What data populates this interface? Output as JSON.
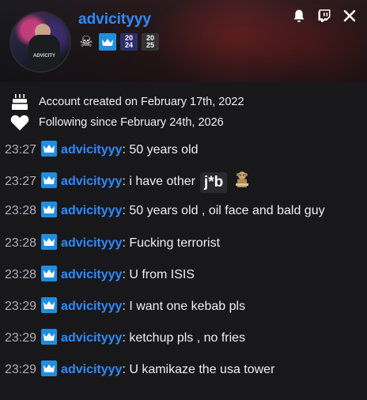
{
  "header": {
    "username": "advicityyy",
    "avatar_text": "ADVICITY",
    "badges": [
      {
        "name": "skull-badge",
        "text": "☠"
      },
      {
        "name": "crown-badge",
        "text": ""
      },
      {
        "name": "sub-badge-24",
        "text": "20\n24"
      },
      {
        "name": "sub-badge-25",
        "text": "20\n25"
      }
    ],
    "icons": [
      "bell-icon",
      "twitch-icon",
      "close-icon"
    ]
  },
  "info": {
    "account_created": "Account created on February 17th, 2022",
    "following_since": "Following since February 24th, 2026"
  },
  "messages": [
    {
      "time": "23:27",
      "user": "advicityyy",
      "text": ": 50 years old"
    },
    {
      "time": "23:27",
      "user": "advicityyy",
      "text": ": i have other",
      "emote": "j*b"
    },
    {
      "time": "23:28",
      "user": "advicityyy",
      "text": ": 50 years old , oil face and bald guy"
    },
    {
      "time": "23:28",
      "user": "advicityyy",
      "text": ": Fucking terrorist"
    },
    {
      "time": "23:28",
      "user": "advicityyy",
      "text": ": U from ISIS"
    },
    {
      "time": "23:29",
      "user": "advicityyy",
      "text": ": I want one kebab pls"
    },
    {
      "time": "23:29",
      "user": "advicityyy",
      "text": ": ketchup pls , no fries"
    },
    {
      "time": "23:29",
      "user": "advicityyy",
      "text": ": U kamikaze the usa tower"
    }
  ],
  "colors": {
    "username": "#2e8bff",
    "crown_badge": "#1f8ee0",
    "timestamp": "#adadb8"
  }
}
